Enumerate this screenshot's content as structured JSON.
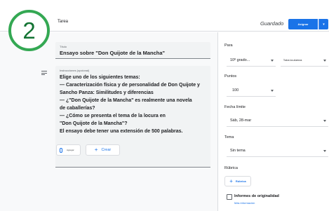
{
  "header": {
    "title": "Tarea",
    "saved_status": "Guardado",
    "assign_button": "Asignar"
  },
  "step_badge": "2",
  "main": {
    "title_field": {
      "label": "Título",
      "value": "Ensayo sobre \"Don Quijote de la Mancha\""
    },
    "instructions_field": {
      "label": "Instrucciones (opcional)",
      "lines": [
        "Elige uno de los siguientes temas:",
        "— Caracterización física y de personalidad de Don Quijote y",
        "Sancho Panza: Similitudes y diferencias",
        "— ¿\"Don Quijote de la Mancha\" es realmente una novela",
        "de caballerías?",
        "— ¿Cómo se presenta el tema de la locura en",
        "\"Don Quijote de la Mancha\"?",
        "El ensayo debe tener una extensión de 500 palabras."
      ]
    },
    "attach_button": "Agregar",
    "create_button": "Crear"
  },
  "sidebar": {
    "for_label": "Para",
    "class_value": "10º grado...",
    "students_value": "Todos los alumnos",
    "points_label": "Puntos",
    "points_value": "100",
    "due_label": "Fecha límite",
    "due_value": "Sáb, 28-mar",
    "topic_label": "Tema",
    "topic_value": "Sin tema",
    "rubric_label": "Rúbrica",
    "rubric_button": "Rúbrica",
    "originality_label": "Informes de originalidad",
    "more_info": "Más información"
  },
  "colors": {
    "accent": "#1a73e8",
    "badge_green": "#34a853"
  }
}
